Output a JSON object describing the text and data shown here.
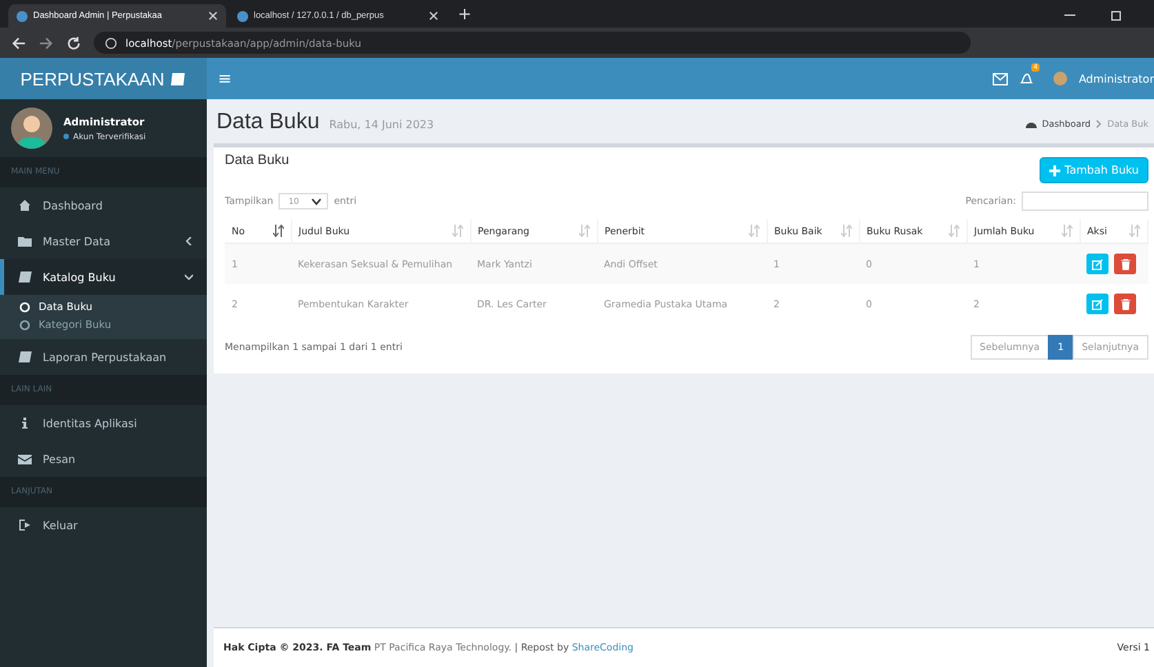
{
  "browser": {
    "tabs": [
      {
        "title": "Dashboard Admin | Perpustakaa",
        "selected": true
      },
      {
        "title": "localhost / 127.0.0.1 / db_perpus",
        "selected": false
      }
    ],
    "new_tab": "+",
    "url_host": "localhost",
    "url_path": "/perpustakaan/app/admin/data-buku"
  },
  "header": {
    "brand": "PERPUSTAKAAN",
    "menu_toggle": "≡",
    "notification_badge": "4",
    "user": "Administrator"
  },
  "user_panel": {
    "name": "Administrator",
    "status": "Akun Terverifikasi"
  },
  "sidebar": [
    {
      "title": "MAIN MENU",
      "items": [
        {
          "label": "Dashboard",
          "selected": false
        },
        {
          "label": "Master Data",
          "selected": false,
          "expanded": false
        },
        {
          "label": "Katalog Buku",
          "selected": true,
          "expanded": true,
          "children": [
            {
              "label": "Data Buku",
              "selected": true
            },
            {
              "label": "Kategori Buku",
              "selected": false
            }
          ]
        },
        {
          "label": "Laporan Perpustakaan",
          "selected": false
        }
      ]
    },
    {
      "title": "LAIN LAIN",
      "items": [
        {
          "label": "Identitas Aplikasi",
          "selected": false
        },
        {
          "label": "Pesan",
          "selected": false
        }
      ]
    },
    {
      "title": "LANJUTAN",
      "items": [
        {
          "label": "Keluar",
          "selected": false
        }
      ]
    }
  ],
  "page": {
    "title": "Data Buku",
    "date": "Rabu, 14 Juni 2023",
    "breadcrumb": [
      "Dashboard",
      "Data Buk"
    ]
  },
  "card": {
    "title": "Data Buku",
    "add_button": "Tambah Buku",
    "length_label": "Tampilkan",
    "length_value": "10",
    "length_suffix": "entri",
    "search_label": "Pencarian:",
    "table": {
      "columns": [
        "No",
        "Judul Buku",
        "Pengarang",
        "Penerbit",
        "Buku Baik",
        "Buku Rusak",
        "Jumlah Buku",
        "Aksi"
      ],
      "rows": [
        [
          "1",
          "Kekerasan Seksual & Pemulihan",
          "Mark Yantzi",
          "Andi Offset",
          "1",
          "0",
          "1"
        ],
        [
          "2",
          "Pembentukan Karakter",
          "DR. Les Carter",
          "Gramedia Pustaka Utama",
          "2",
          "0",
          "2"
        ]
      ]
    },
    "info": "Menampilkan 1 sampai 1 dari 1 entri",
    "pagination": [
      {
        "label": "Sebelumnya",
        "selected": false
      },
      {
        "label": "1",
        "selected": true
      },
      {
        "label": "Selanjutnya",
        "selected": false
      }
    ]
  },
  "footer": {
    "copyright": "Hak Cipta © 2023. FA Team",
    "company": "PT Pacifica Raya Technology.",
    "repost": "| Repost by",
    "link": "ShareCoding",
    "version": "Versi 1"
  }
}
